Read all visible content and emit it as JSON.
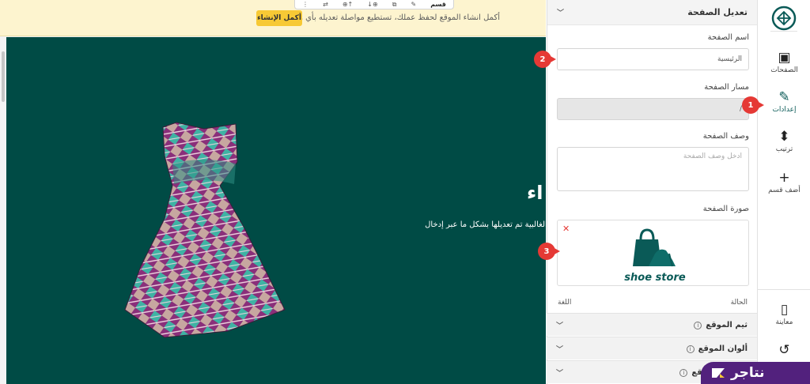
{
  "banner": {
    "message": "أكمل انشاء الموقع لحفظ عملك، تستطيع مواصلة تعديله بأي وقت",
    "complete_label": "أكمل الإنشاء"
  },
  "section_toolbar": {
    "label": "قسم",
    "icons": [
      "edit-icon",
      "duplicate-icon",
      "add-below-icon",
      "add-above-icon",
      "swap-icon",
      "more-icon"
    ]
  },
  "hero": {
    "title_fragment": "اء",
    "subtitle_fragment": "ولكن الغالبية تم تعديلها بشكل ما عبر إدخال"
  },
  "panel": {
    "header": "تعديل الصفحة",
    "page_name_label": "اسم الصفحة",
    "page_name_value": "الرئيسية",
    "page_path_label": "مسار الصفحة",
    "page_path_value": "/",
    "page_desc_label": "وصف الصفحة",
    "page_desc_placeholder": "ادخل وصف الصفحة",
    "page_image_label": "صورة الصفحة",
    "image_logo_text": "shoe store",
    "status_label": "الحالة",
    "language_label": "اللغة",
    "accordions": [
      {
        "label": "ثيم الموقع"
      },
      {
        "label": "ألوان الموقع"
      },
      {
        "label": "خطوط الموقع"
      }
    ]
  },
  "rail": {
    "items": [
      {
        "label": "الصفحات",
        "icon": "pages-icon"
      },
      {
        "label": "إعدادات",
        "icon": "pencil-icon",
        "active": true
      },
      {
        "label": "ترتيب",
        "icon": "sort-icon"
      },
      {
        "label": "أضف قسم",
        "icon": "plus-icon"
      },
      {
        "label": "معاينة",
        "icon": "phone-icon"
      },
      {
        "label": "",
        "icon": "history-icon"
      }
    ]
  },
  "markers": [
    "1",
    "2",
    "3"
  ],
  "brand": {
    "name": "نتاجر"
  },
  "colors": {
    "accent": "#0a5a57",
    "hero_bg": "#004b45",
    "banner_bg": "#fdf4cf",
    "cta": "#f7c935",
    "marker": "#e53935",
    "brand": "#52217d"
  }
}
